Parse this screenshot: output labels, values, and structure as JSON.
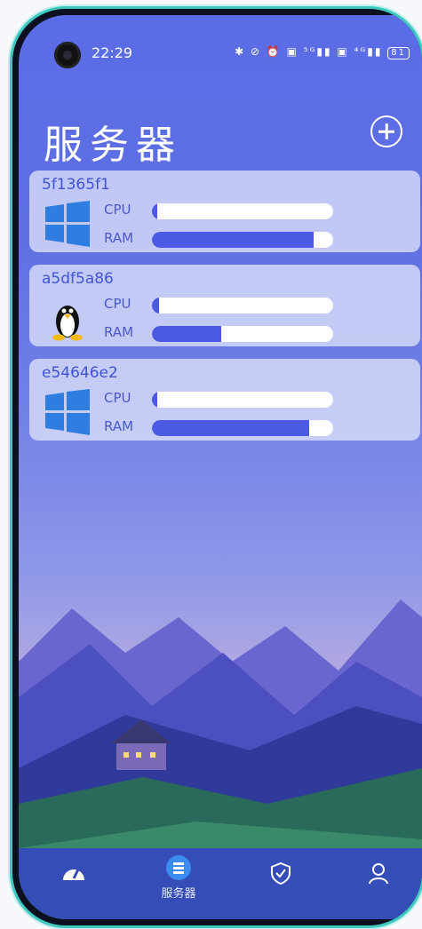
{
  "status_bar": {
    "time": "22:29",
    "icons": "✱ ⊘ ⏰ ▣ ⁵ᴳ▮▮ ▣ ⁴ᴳ▮▮",
    "battery": "81"
  },
  "header": {
    "title": "服务器"
  },
  "servers": [
    {
      "name": "5f1365f1",
      "os": "windows",
      "cpu_label": "CPU",
      "ram_label": "RAM",
      "cpu": 0.03,
      "ram": 0.89
    },
    {
      "name": "a5df5a86",
      "os": "linux",
      "cpu_label": "CPU",
      "ram_label": "RAM",
      "cpu": 0.04,
      "ram": 0.38
    },
    {
      "name": "e54646e2",
      "os": "windows",
      "cpu_label": "CPU",
      "ram_label": "RAM",
      "cpu": 0.01,
      "ram": 0.87
    }
  ],
  "tabs": [
    {
      "icon": "dashboard-icon",
      "label": ""
    },
    {
      "icon": "server-icon",
      "label": "服务器",
      "active": true
    },
    {
      "icon": "shield-check-icon",
      "label": ""
    },
    {
      "icon": "user-icon",
      "label": ""
    }
  ],
  "colors": {
    "accent": "#4a5ae2",
    "card_bg": "#dce1fa",
    "active_tab": "#3a8cf0"
  }
}
